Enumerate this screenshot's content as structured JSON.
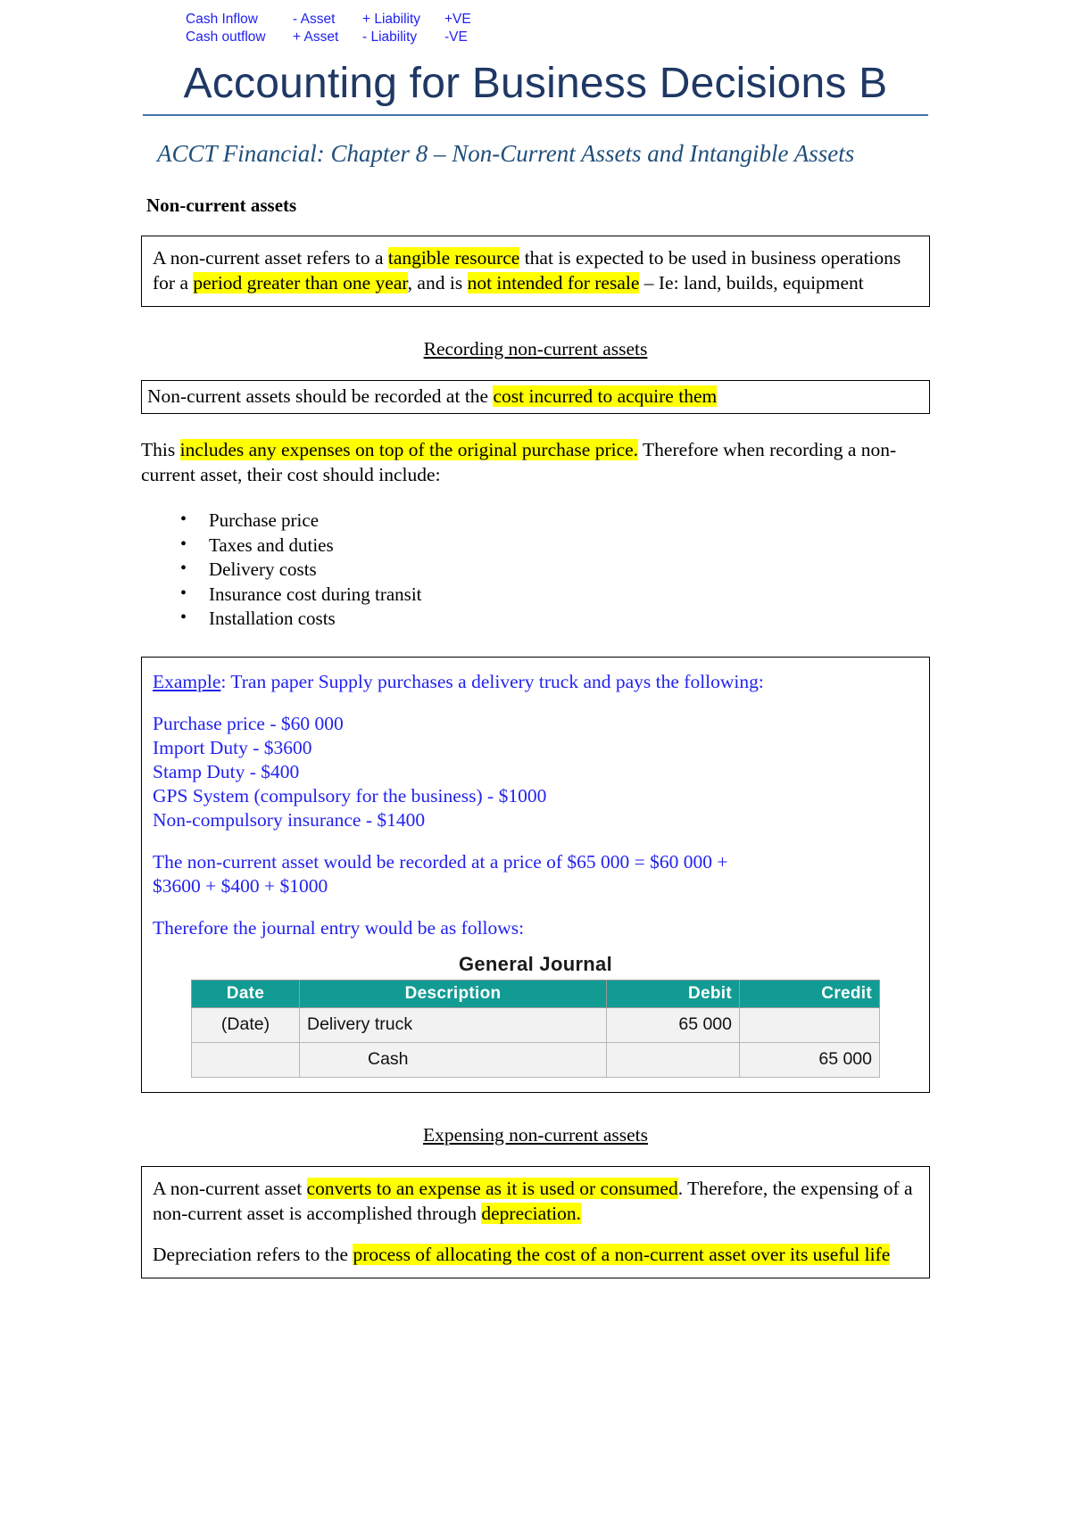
{
  "header_notes": {
    "line1": {
      "label": "Cash Inflow",
      "asset": "- Asset",
      "liability": "+ Liability",
      "ve": "+VE"
    },
    "line2": {
      "label": "Cash outflow",
      "asset": "+ Asset",
      "liability": "- Liability",
      "ve": "-VE"
    }
  },
  "title": "Accounting for Business Decisions B",
  "subtitle": "ACCT Financial: Chapter 8 – Non-Current Assets and Intangible Assets",
  "section_heading": "Non-current assets",
  "definition_box": {
    "t1": "A non-current asset refers to a ",
    "h1": "tangible resource",
    "t2": " that is expected to be used in business operations for a ",
    "h2": "period greater than one year",
    "t3": ", and is ",
    "h3": "not intended for resale",
    "t4": " – Ie: land, builds, equipment"
  },
  "recording_heading": "Recording non-current assets",
  "recording_box": {
    "t1": "Non-current assets should be recorded at the ",
    "h1": "cost incurred to acquire them"
  },
  "includes_para": {
    "t1": "This ",
    "h1": "includes any expenses on top of the original purchase price.",
    "t2": " Therefore when recording a non-current asset, their cost should include:"
  },
  "cost_bullets": [
    "Purchase price",
    "Taxes and duties",
    "Delivery costs",
    "Insurance cost during transit",
    "Installation costs"
  ],
  "example": {
    "lead_label": "Example",
    "lead_rest": ": Tran paper Supply purchases a delivery truck and pays the following:",
    "costs": [
      "Purchase price - $60 000",
      "Import Duty - $3600",
      "Stamp Duty - $400",
      "GPS System (compulsory for the business) - $1000",
      "Non-compulsory insurance - $1400"
    ],
    "result_line1": "The non-current asset would be recorded at a price of  $65 000 = $60 000 +",
    "result_line2": "$3600 + $400 + $1000",
    "journal_intro": "Therefore the journal entry would be as follows:",
    "journal": {
      "title": "General Journal",
      "columns": [
        "Date",
        "Description",
        "Debit",
        "Credit"
      ],
      "rows": [
        {
          "date": "(Date)",
          "description": "Delivery truck",
          "debit": "65 000",
          "credit": "",
          "indent": false
        },
        {
          "date": "",
          "description": "Cash",
          "debit": "",
          "credit": "65 000",
          "indent": true
        }
      ]
    }
  },
  "expensing_heading": "Expensing non-current assets",
  "expensing_box": {
    "p1_t1": "A non-current asset ",
    "p1_h1": "converts to an expense as it is used or consumed",
    "p1_t2": ". Therefore, the expensing of a non-current asset is accomplished through ",
    "p1_h2": "depreciation.",
    "p2_t1": "Depreciation refers to the ",
    "p2_h1": "process of allocating the cost of a non-current asset over its useful life"
  },
  "colors": {
    "title_navy": "#1f3864",
    "subtitle_blue": "#1f4e79",
    "example_blue": "#2222ee",
    "highlight_yellow": "#ffff00",
    "table_header_teal": "#129b93"
  }
}
